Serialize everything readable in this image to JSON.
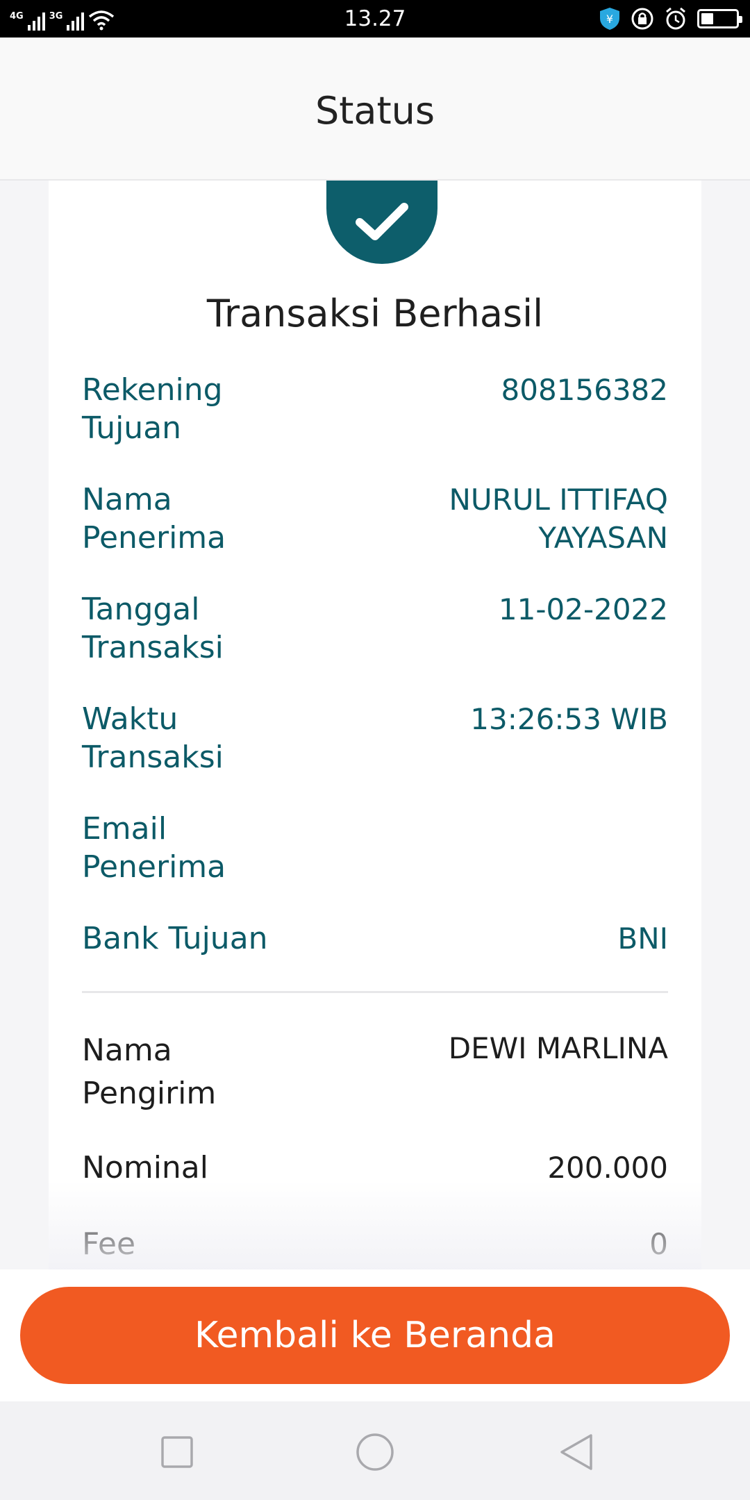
{
  "status_bar": {
    "network_1": "4G",
    "network_2": "3G",
    "time": "13.27",
    "icons": [
      "signal-icon",
      "wifi-icon",
      "shield-icon",
      "lock-rotation-icon",
      "alarm-icon",
      "battery-icon"
    ],
    "battery_level": 0.35
  },
  "header": {
    "title": "Status"
  },
  "result": {
    "icon": "checkmark-icon",
    "title": "Transaksi Berhasil"
  },
  "details": [
    {
      "label": "Rekening\nTujuan",
      "value": "808156382"
    },
    {
      "label": "Nama\nPenerima",
      "value": "NURUL ITTIFAQ\nYAYASAN"
    },
    {
      "label": "Tanggal\nTransaksi",
      "value": "11-02-2022"
    },
    {
      "label": "Waktu\nTransaksi",
      "value": "13:26:53 WIB"
    },
    {
      "label": "Email\nPenerima",
      "value": ""
    },
    {
      "label": "Bank Tujuan",
      "value": "BNI"
    }
  ],
  "sender_details": [
    {
      "label": "Nama\nPengirim",
      "value": "DEWI MARLINA"
    },
    {
      "label": "Nominal",
      "value": "200.000"
    },
    {
      "label": "Fee",
      "value": "0"
    }
  ],
  "actions": {
    "back_home": "Kembali ke Beranda"
  },
  "nav": {
    "icons": [
      "recent-apps-icon",
      "home-icon",
      "back-icon"
    ]
  },
  "colors": {
    "accent": "#0c5a67",
    "button": "#f15a22"
  }
}
